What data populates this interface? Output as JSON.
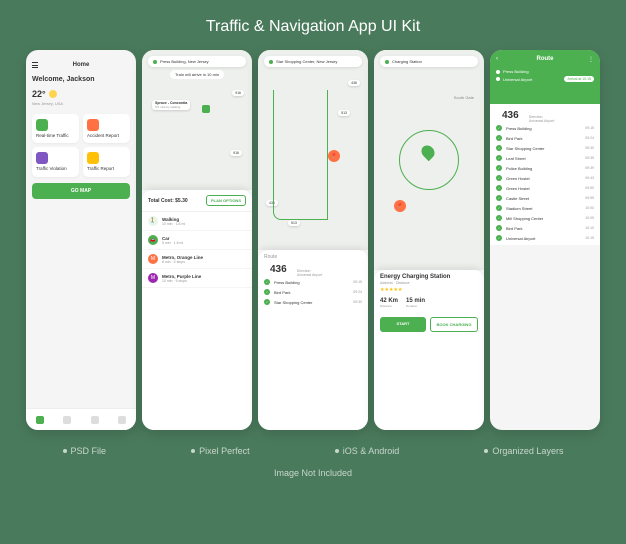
{
  "title": "Traffic & Navigation App UI Kit",
  "features": [
    "PSD File",
    "Pixel Perfect",
    "iOS & Android",
    "Organized Layers"
  ],
  "footer_note": "Image Not Included",
  "screen1": {
    "header": "Home",
    "welcome": "Welcome, Jackson",
    "temp": "22°",
    "location": "New Jersey, USA",
    "tiles": [
      {
        "label": "Real-time Traffic"
      },
      {
        "label": "Accident Report"
      },
      {
        "label": "Traffic Violation"
      },
      {
        "label": "Traffic Report"
      }
    ],
    "cta": "GO MAP"
  },
  "screen2": {
    "search": "Press Building, New Jersey",
    "eta": "Train will arrive in 10 min",
    "map_labels": {
      "spruce": "Spruce - Concordia",
      "spruce_sub": "0.5 mile by walking"
    },
    "markers": [
      "916",
      "916"
    ],
    "total_cost_label": "Total Cost:",
    "total_cost": "$5.30",
    "plan_btn": "PLAN OPTIONS",
    "options": [
      {
        "title": "Walking",
        "sub": "10 min · 1.8 mi",
        "price": ""
      },
      {
        "title": "Car",
        "sub": "5 min · 1.8 mi",
        "price": ""
      },
      {
        "title": "Metro, Orange Line",
        "sub": "8 min · 4 stops",
        "price": ""
      },
      {
        "title": "Metro, Purple Line",
        "sub": "10 min · 5 stops",
        "price": ""
      }
    ]
  },
  "screen3": {
    "search": "Star Shopping Center, New Jersey",
    "markers": [
      "436",
      "513",
      "436",
      "513"
    ],
    "route_label": "Route",
    "route_num": "436",
    "route_meta": "Direction\nUniversal Airport",
    "stops": [
      {
        "name": "Press Building",
        "time": "09:15"
      },
      {
        "name": "Bird Park",
        "time": "09:24"
      },
      {
        "name": "Star Shopping Center",
        "time": "09:30"
      }
    ]
  },
  "screen4": {
    "search": "Charging Station",
    "map_label": "South Gate",
    "station_name": "Energy Charging Station",
    "station_sub": "Address · Distance",
    "stats": [
      {
        "val": "42 Km",
        "label": "Distance"
      },
      {
        "val": "15 min",
        "label": "Duration"
      }
    ],
    "btn1": "START",
    "btn2": "BOOK CHARGING"
  },
  "screen5": {
    "header": "Route",
    "from": "Press Building",
    "to": "Universal Airport",
    "arrival": "Arrival at 10:15",
    "route_num": "436",
    "route_meta": "Direction\nUniversal Airport",
    "stops": [
      {
        "name": "Press Building",
        "time": "09:15"
      },
      {
        "name": "Bird Park",
        "time": "09:24"
      },
      {
        "name": "Star Shopping Center",
        "time": "09:30"
      },
      {
        "name": "Leaf Street",
        "time": "09:35"
      },
      {
        "name": "Police Building",
        "time": "09:39"
      },
      {
        "name": "Green Hostel",
        "time": "09:43"
      },
      {
        "name": "Green Hostel",
        "time": "09:50"
      },
      {
        "name": "Castle Street",
        "time": "09:55"
      },
      {
        "name": "Stadium Street",
        "time": "10:00"
      },
      {
        "name": "Mill Shopping Center",
        "time": "10:05"
      },
      {
        "name": "Bird Park",
        "time": "10:10"
      },
      {
        "name": "Universal Airport",
        "time": "10:15"
      }
    ]
  }
}
